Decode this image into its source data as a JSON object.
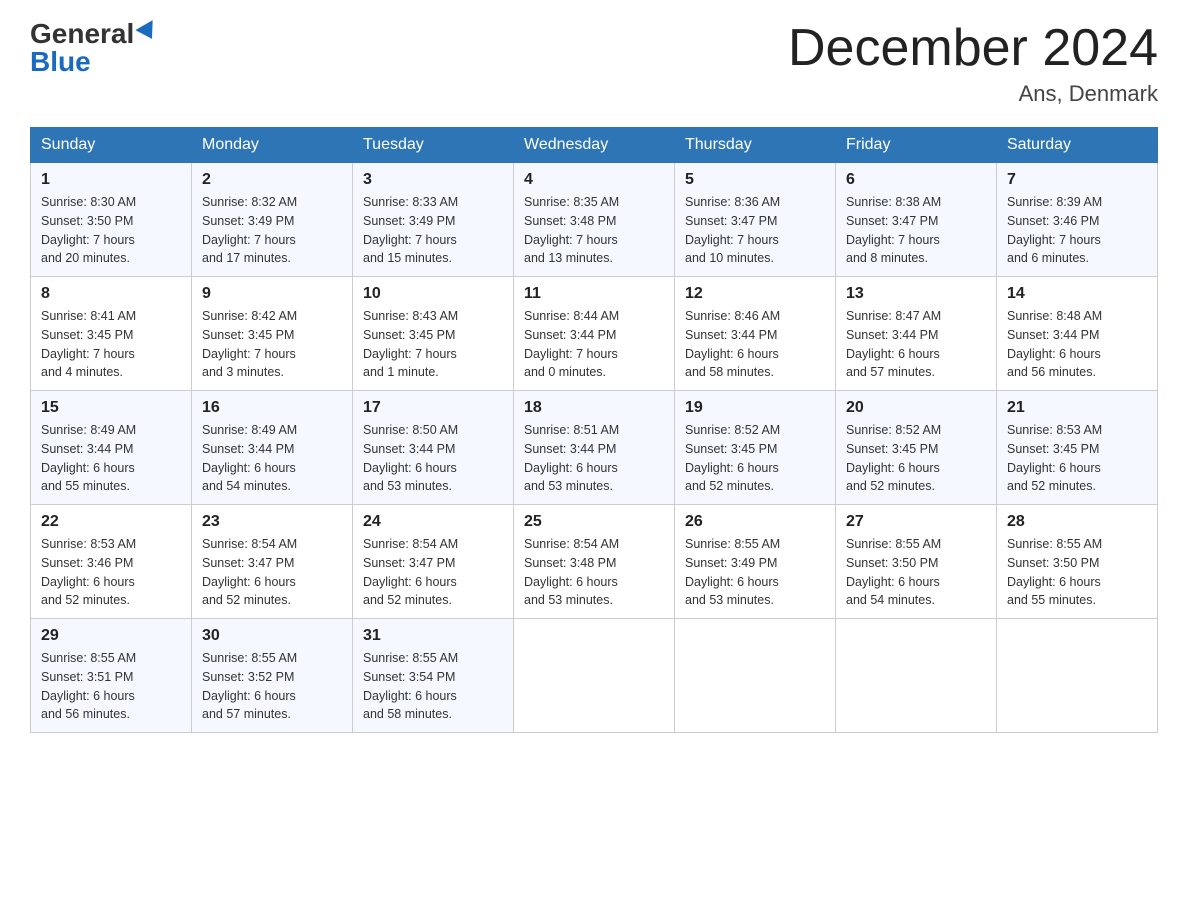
{
  "header": {
    "logo_general": "General",
    "logo_blue": "Blue",
    "title": "December 2024",
    "location": "Ans, Denmark"
  },
  "days_of_week": [
    "Sunday",
    "Monday",
    "Tuesday",
    "Wednesday",
    "Thursday",
    "Friday",
    "Saturday"
  ],
  "weeks": [
    [
      {
        "day": "1",
        "sunrise": "8:30 AM",
        "sunset": "3:50 PM",
        "daylight": "7 hours and 20 minutes."
      },
      {
        "day": "2",
        "sunrise": "8:32 AM",
        "sunset": "3:49 PM",
        "daylight": "7 hours and 17 minutes."
      },
      {
        "day": "3",
        "sunrise": "8:33 AM",
        "sunset": "3:49 PM",
        "daylight": "7 hours and 15 minutes."
      },
      {
        "day": "4",
        "sunrise": "8:35 AM",
        "sunset": "3:48 PM",
        "daylight": "7 hours and 13 minutes."
      },
      {
        "day": "5",
        "sunrise": "8:36 AM",
        "sunset": "3:47 PM",
        "daylight": "7 hours and 10 minutes."
      },
      {
        "day": "6",
        "sunrise": "8:38 AM",
        "sunset": "3:47 PM",
        "daylight": "7 hours and 8 minutes."
      },
      {
        "day": "7",
        "sunrise": "8:39 AM",
        "sunset": "3:46 PM",
        "daylight": "7 hours and 6 minutes."
      }
    ],
    [
      {
        "day": "8",
        "sunrise": "8:41 AM",
        "sunset": "3:45 PM",
        "daylight": "7 hours and 4 minutes."
      },
      {
        "day": "9",
        "sunrise": "8:42 AM",
        "sunset": "3:45 PM",
        "daylight": "7 hours and 3 minutes."
      },
      {
        "day": "10",
        "sunrise": "8:43 AM",
        "sunset": "3:45 PM",
        "daylight": "7 hours and 1 minute."
      },
      {
        "day": "11",
        "sunrise": "8:44 AM",
        "sunset": "3:44 PM",
        "daylight": "7 hours and 0 minutes."
      },
      {
        "day": "12",
        "sunrise": "8:46 AM",
        "sunset": "3:44 PM",
        "daylight": "6 hours and 58 minutes."
      },
      {
        "day": "13",
        "sunrise": "8:47 AM",
        "sunset": "3:44 PM",
        "daylight": "6 hours and 57 minutes."
      },
      {
        "day": "14",
        "sunrise": "8:48 AM",
        "sunset": "3:44 PM",
        "daylight": "6 hours and 56 minutes."
      }
    ],
    [
      {
        "day": "15",
        "sunrise": "8:49 AM",
        "sunset": "3:44 PM",
        "daylight": "6 hours and 55 minutes."
      },
      {
        "day": "16",
        "sunrise": "8:49 AM",
        "sunset": "3:44 PM",
        "daylight": "6 hours and 54 minutes."
      },
      {
        "day": "17",
        "sunrise": "8:50 AM",
        "sunset": "3:44 PM",
        "daylight": "6 hours and 53 minutes."
      },
      {
        "day": "18",
        "sunrise": "8:51 AM",
        "sunset": "3:44 PM",
        "daylight": "6 hours and 53 minutes."
      },
      {
        "day": "19",
        "sunrise": "8:52 AM",
        "sunset": "3:45 PM",
        "daylight": "6 hours and 52 minutes."
      },
      {
        "day": "20",
        "sunrise": "8:52 AM",
        "sunset": "3:45 PM",
        "daylight": "6 hours and 52 minutes."
      },
      {
        "day": "21",
        "sunrise": "8:53 AM",
        "sunset": "3:45 PM",
        "daylight": "6 hours and 52 minutes."
      }
    ],
    [
      {
        "day": "22",
        "sunrise": "8:53 AM",
        "sunset": "3:46 PM",
        "daylight": "6 hours and 52 minutes."
      },
      {
        "day": "23",
        "sunrise": "8:54 AM",
        "sunset": "3:47 PM",
        "daylight": "6 hours and 52 minutes."
      },
      {
        "day": "24",
        "sunrise": "8:54 AM",
        "sunset": "3:47 PM",
        "daylight": "6 hours and 52 minutes."
      },
      {
        "day": "25",
        "sunrise": "8:54 AM",
        "sunset": "3:48 PM",
        "daylight": "6 hours and 53 minutes."
      },
      {
        "day": "26",
        "sunrise": "8:55 AM",
        "sunset": "3:49 PM",
        "daylight": "6 hours and 53 minutes."
      },
      {
        "day": "27",
        "sunrise": "8:55 AM",
        "sunset": "3:50 PM",
        "daylight": "6 hours and 54 minutes."
      },
      {
        "day": "28",
        "sunrise": "8:55 AM",
        "sunset": "3:50 PM",
        "daylight": "6 hours and 55 minutes."
      }
    ],
    [
      {
        "day": "29",
        "sunrise": "8:55 AM",
        "sunset": "3:51 PM",
        "daylight": "6 hours and 56 minutes."
      },
      {
        "day": "30",
        "sunrise": "8:55 AM",
        "sunset": "3:52 PM",
        "daylight": "6 hours and 57 minutes."
      },
      {
        "day": "31",
        "sunrise": "8:55 AM",
        "sunset": "3:54 PM",
        "daylight": "6 hours and 58 minutes."
      },
      null,
      null,
      null,
      null
    ]
  ],
  "labels": {
    "sunrise": "Sunrise:",
    "sunset": "Sunset:",
    "daylight": "Daylight:"
  }
}
